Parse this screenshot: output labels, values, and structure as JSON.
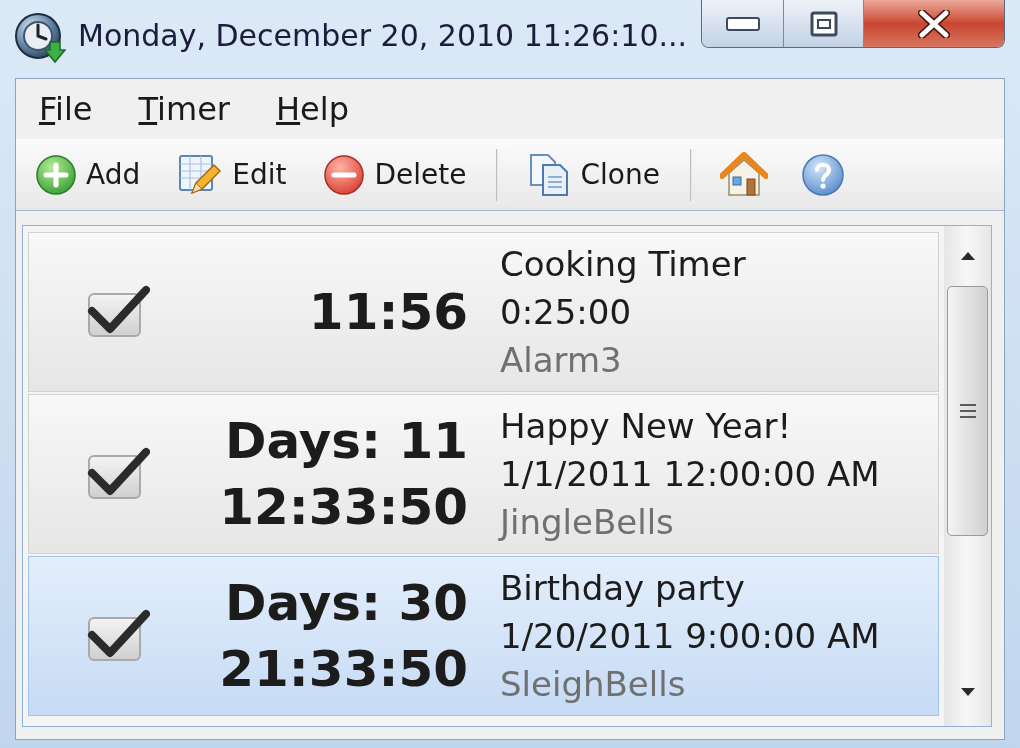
{
  "window": {
    "title": "Monday, December 20, 2010 11:26:10..."
  },
  "menu": [
    "File",
    "Timer",
    "Help"
  ],
  "toolbar": [
    {
      "kind": "button",
      "label": "Add"
    },
    {
      "kind": "button",
      "label": "Edit"
    },
    {
      "kind": "button",
      "label": "Delete"
    },
    {
      "kind": "separator"
    },
    {
      "kind": "button",
      "label": "Clone"
    },
    {
      "kind": "separator"
    },
    {
      "kind": "iconbutton"
    },
    {
      "kind": "iconbutton"
    }
  ],
  "timers": [
    {
      "selected": false,
      "checked": true,
      "countdown": [
        "11:56"
      ],
      "name": "Cooking Timer",
      "time": "0:25:00",
      "sound": "Alarm3"
    },
    {
      "selected": false,
      "checked": true,
      "countdown": [
        "Days: 11",
        "12:33:50"
      ],
      "name": "Happy New Year!",
      "time": "1/1/2011 12:00:00 AM",
      "sound": "JingleBells"
    },
    {
      "selected": true,
      "checked": true,
      "countdown": [
        "Days: 30",
        "21:33:50"
      ],
      "name": "Birthday party",
      "time": "1/20/2011 9:00:00 AM",
      "sound": "SleighBells"
    }
  ]
}
